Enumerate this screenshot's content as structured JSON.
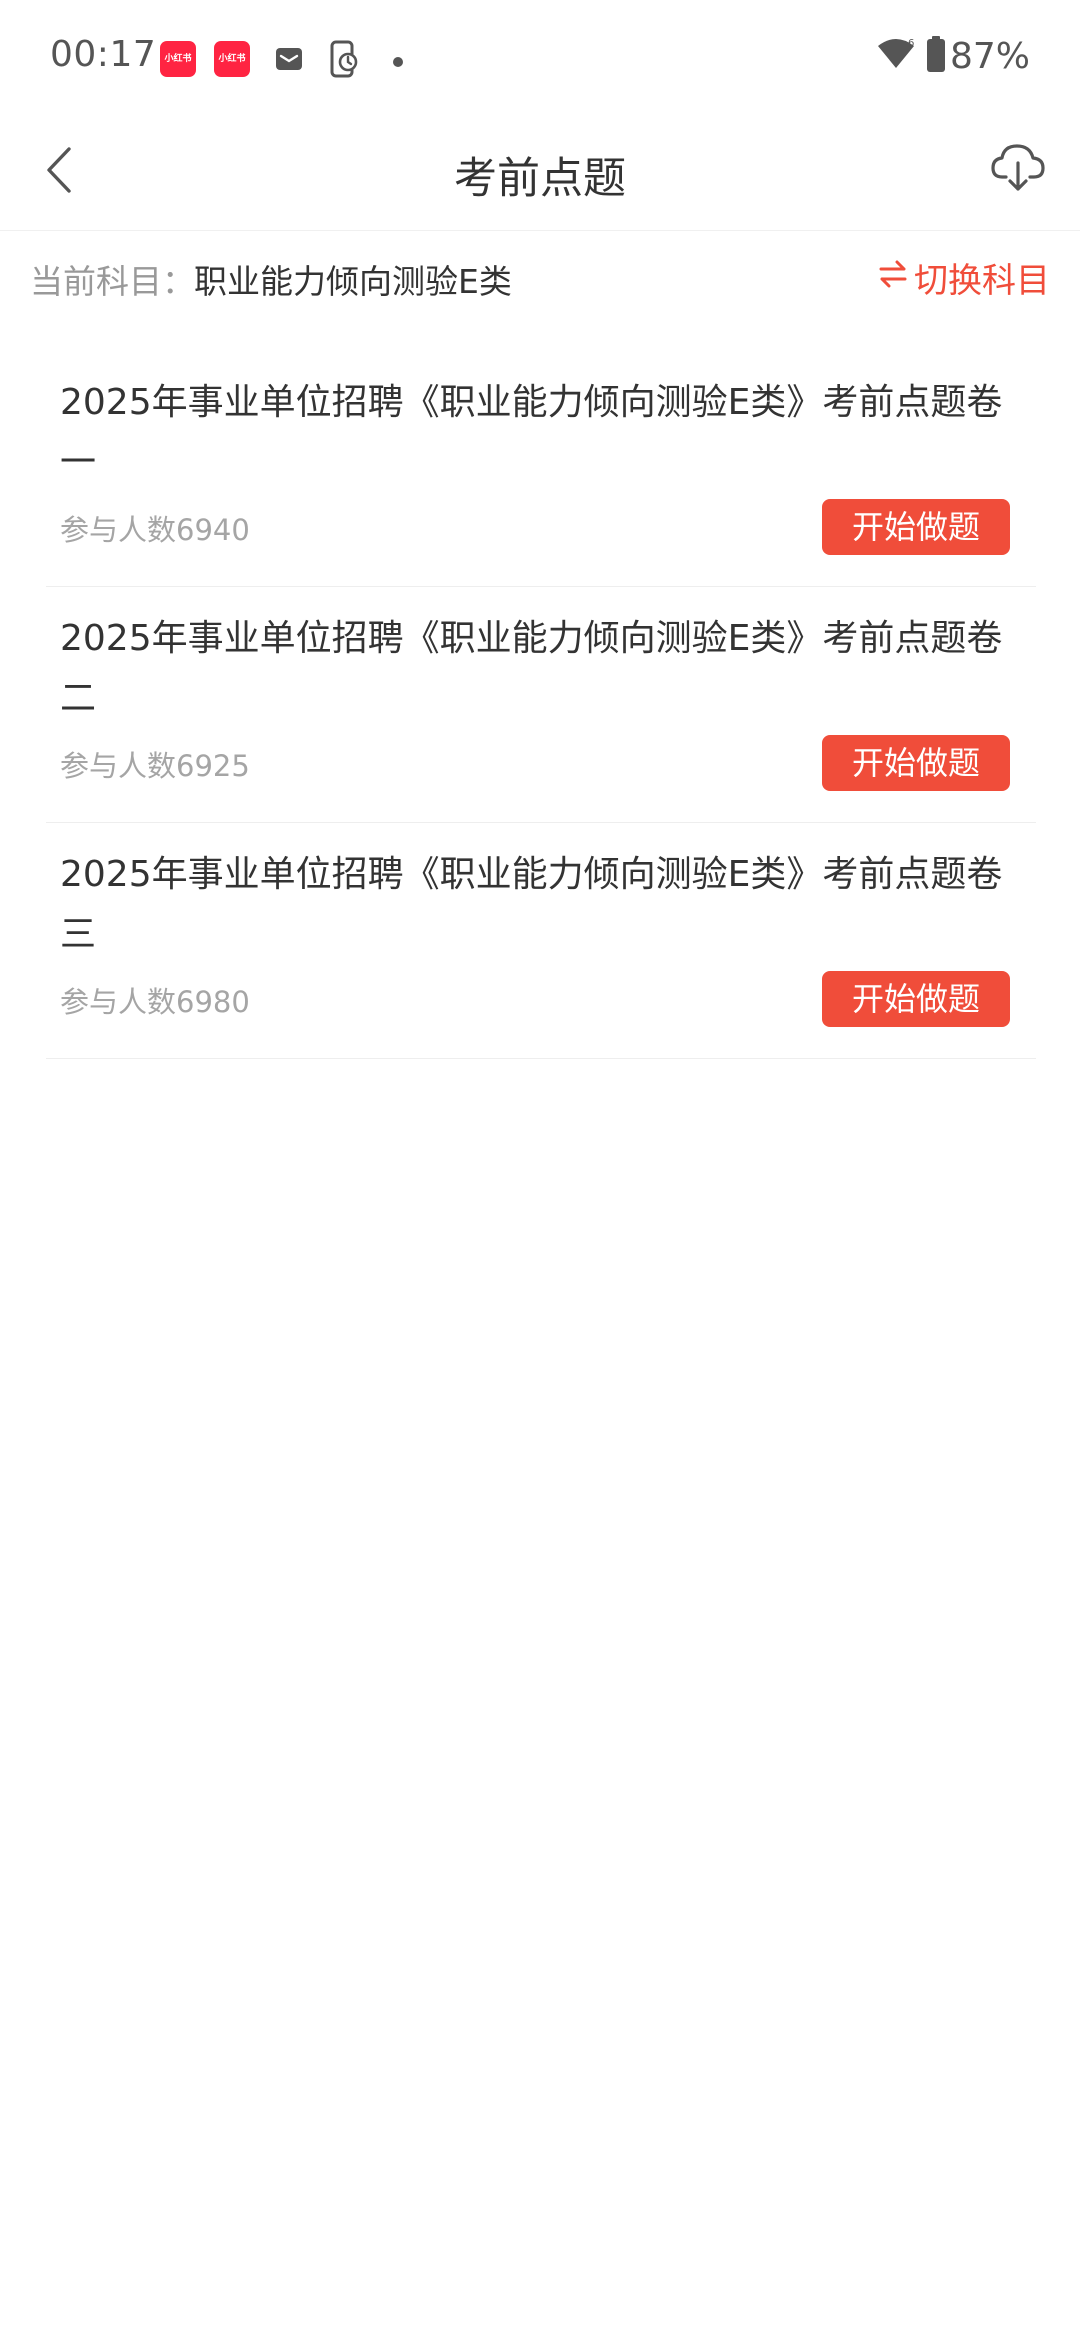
{
  "status_bar": {
    "time": "00:17",
    "app_badges": [
      "小红书",
      "小红书"
    ],
    "battery_percent": "87%",
    "icons": [
      "xiaohongshu-app-icon",
      "xiaohongshu-app-icon",
      "mail-icon",
      "phone-sync-icon",
      "dot-icon",
      "wifi-icon",
      "battery-icon"
    ]
  },
  "header": {
    "title": "考前点题",
    "back_icon": "chevron-left-icon",
    "download_icon": "cloud-download-icon"
  },
  "subject": {
    "label": "当前科目：",
    "value": "职业能力倾向测验E类",
    "switch_label": "切换科目",
    "switch_icon": "swap-arrows-icon"
  },
  "exams": [
    {
      "title": "2025年事业单位招聘《职业能力倾向测验E类》考前点题卷一",
      "participants": "参与人数6940",
      "button_label": "开始做题"
    },
    {
      "title": "2025年事业单位招聘《职业能力倾向测验E类》考前点题卷二",
      "participants": "参与人数6925",
      "button_label": "开始做题"
    },
    {
      "title": "2025年事业单位招聘《职业能力倾向测验E类》考前点题卷三",
      "participants": "参与人数6980",
      "button_label": "开始做题"
    }
  ],
  "colors": {
    "accent": "#f04d3a",
    "badge": "#ff2442",
    "title_text": "#333333",
    "muted_text": "#999999"
  }
}
